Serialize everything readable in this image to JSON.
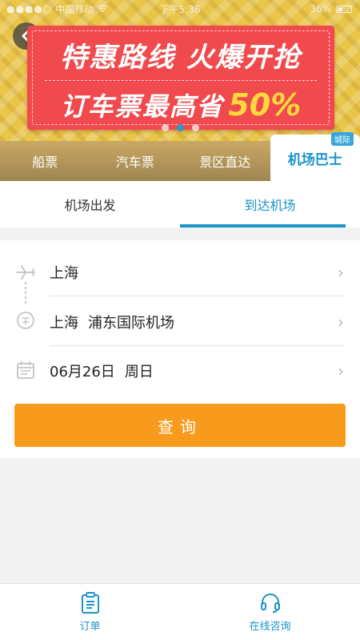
{
  "status_bar": {
    "carrier": "中国移动",
    "time": "下午5:36",
    "battery": "36%"
  },
  "banner": {
    "title": "特惠路线 火爆开抢",
    "subtitle": "订车票最高省",
    "percent": "50%",
    "page_count": 3,
    "active_page": 2
  },
  "category_tabs": [
    {
      "label": "船票"
    },
    {
      "label": "汽车票"
    },
    {
      "label": "景区直达"
    },
    {
      "label": "机场巴士",
      "badge": "城际",
      "active": true
    }
  ],
  "sub_tabs": [
    {
      "label": "机场出发"
    },
    {
      "label": "到达机场",
      "active": true
    }
  ],
  "form": {
    "origin": "上海",
    "destination_city": "上海",
    "destination_airport": "浦东国际机场",
    "date": "06月26日",
    "weekday": "周日"
  },
  "query_button": "查询",
  "bottom_nav": [
    {
      "label": "订单",
      "icon": "clipboard-icon"
    },
    {
      "label": "在线咨询",
      "icon": "headset-icon"
    }
  ],
  "colors": {
    "accent": "#1a93c8",
    "button": "#f89b1c",
    "promo": "#f04a4e"
  }
}
